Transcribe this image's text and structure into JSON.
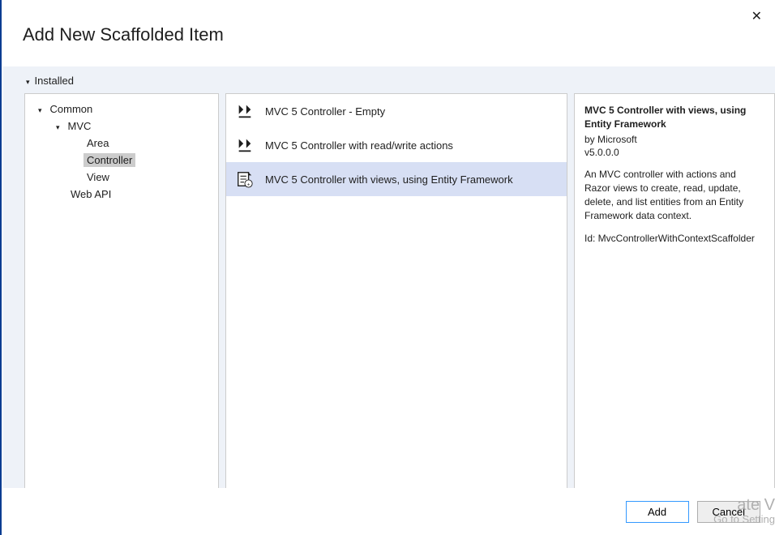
{
  "dialog": {
    "title": "Add New Scaffolded Item"
  },
  "close": {
    "glyph": "✕"
  },
  "installed_header": "Installed",
  "tree": {
    "common": "Common",
    "mvc": "MVC",
    "area": "Area",
    "controller": "Controller",
    "view": "View",
    "webapi": "Web API"
  },
  "list": {
    "items": [
      {
        "label": "MVC 5 Controller - Empty",
        "icon": "controller-icon"
      },
      {
        "label": "MVC 5 Controller with read/write actions",
        "icon": "controller-icon"
      },
      {
        "label": "MVC 5 Controller with views, using Entity Framework",
        "icon": "controller-views-icon"
      }
    ]
  },
  "detail": {
    "title": "MVC 5 Controller with views, using Entity Framework",
    "by": "by Microsoft",
    "version": "v5.0.0.0",
    "description": "An MVC controller with actions and Razor views to create, read, update, delete, and list entities from an Entity Framework data context.",
    "id_label": "Id: MvcControllerWithContextScaffolder"
  },
  "buttons": {
    "add": "Add",
    "cancel": "Cancel"
  },
  "watermark": {
    "line1": "ate V",
    "line2": "Go to Setting"
  }
}
